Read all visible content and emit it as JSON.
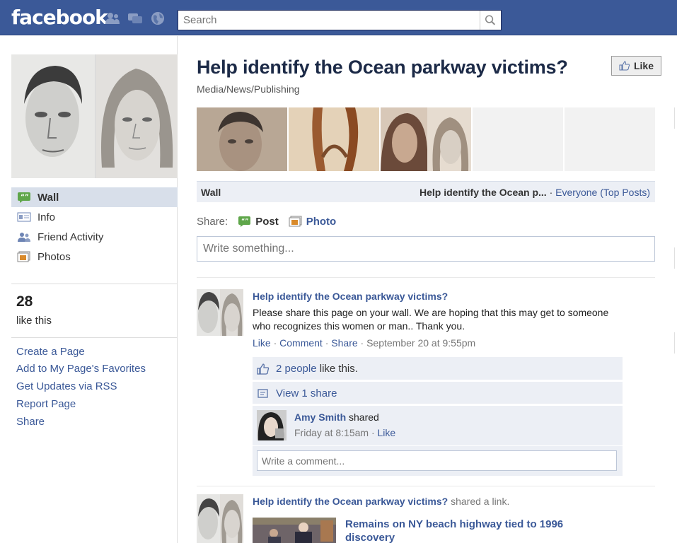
{
  "brand": {
    "logo": "facebook"
  },
  "search": {
    "placeholder": "Search"
  },
  "nav": {
    "items": [
      {
        "label": "Wall",
        "icon": "wall-icon",
        "active": true
      },
      {
        "label": "Info",
        "icon": "info-icon"
      },
      {
        "label": "Friend Activity",
        "icon": "friends-icon"
      },
      {
        "label": "Photos",
        "icon": "photos-icon"
      }
    ]
  },
  "stats": {
    "count": "28",
    "label": "like this"
  },
  "left_links": [
    "Create a Page",
    "Add to My Page's Favorites",
    "Get Updates via RSS",
    "Report Page",
    "Share"
  ],
  "page": {
    "title": "Help identify the Ocean parkway victims?",
    "category": "Media/News/Publishing",
    "like_button": "Like"
  },
  "wall": {
    "label": "Wall",
    "filter_page": "Help identify the Ocean p...",
    "filter_sep": " · ",
    "filter_link": "Everyone (Top Posts)"
  },
  "share": {
    "label": "Share:",
    "post": "Post",
    "photo": "Photo",
    "write_placeholder": "Write something..."
  },
  "story1": {
    "author": "Help identify the Ocean parkway victims?",
    "body": "Please share this page on your wall. We are hoping that this may get to someone who recognizes this women or man.. Thank you.",
    "actions": {
      "like": "Like",
      "comment": "Comment",
      "share": "Share",
      "time": "September 20 at 9:55pm"
    },
    "likes_link": "2 people",
    "likes_text": " like this.",
    "view_share": "View 1 share",
    "shared": {
      "name": "Amy Smith",
      "action": " shared",
      "time": "Friday at 8:15am",
      "like": "Like"
    },
    "comment_placeholder": "Write a comment..."
  },
  "story2": {
    "author": "Help identify the Ocean parkway victims?",
    "action": " shared a link.",
    "link_title": "Remains on NY beach highway tied to 1996 discovery"
  },
  "colors": {
    "brand_blue": "#3b5998",
    "link": "#3b5998",
    "ufi_bg": "#eceff5"
  }
}
